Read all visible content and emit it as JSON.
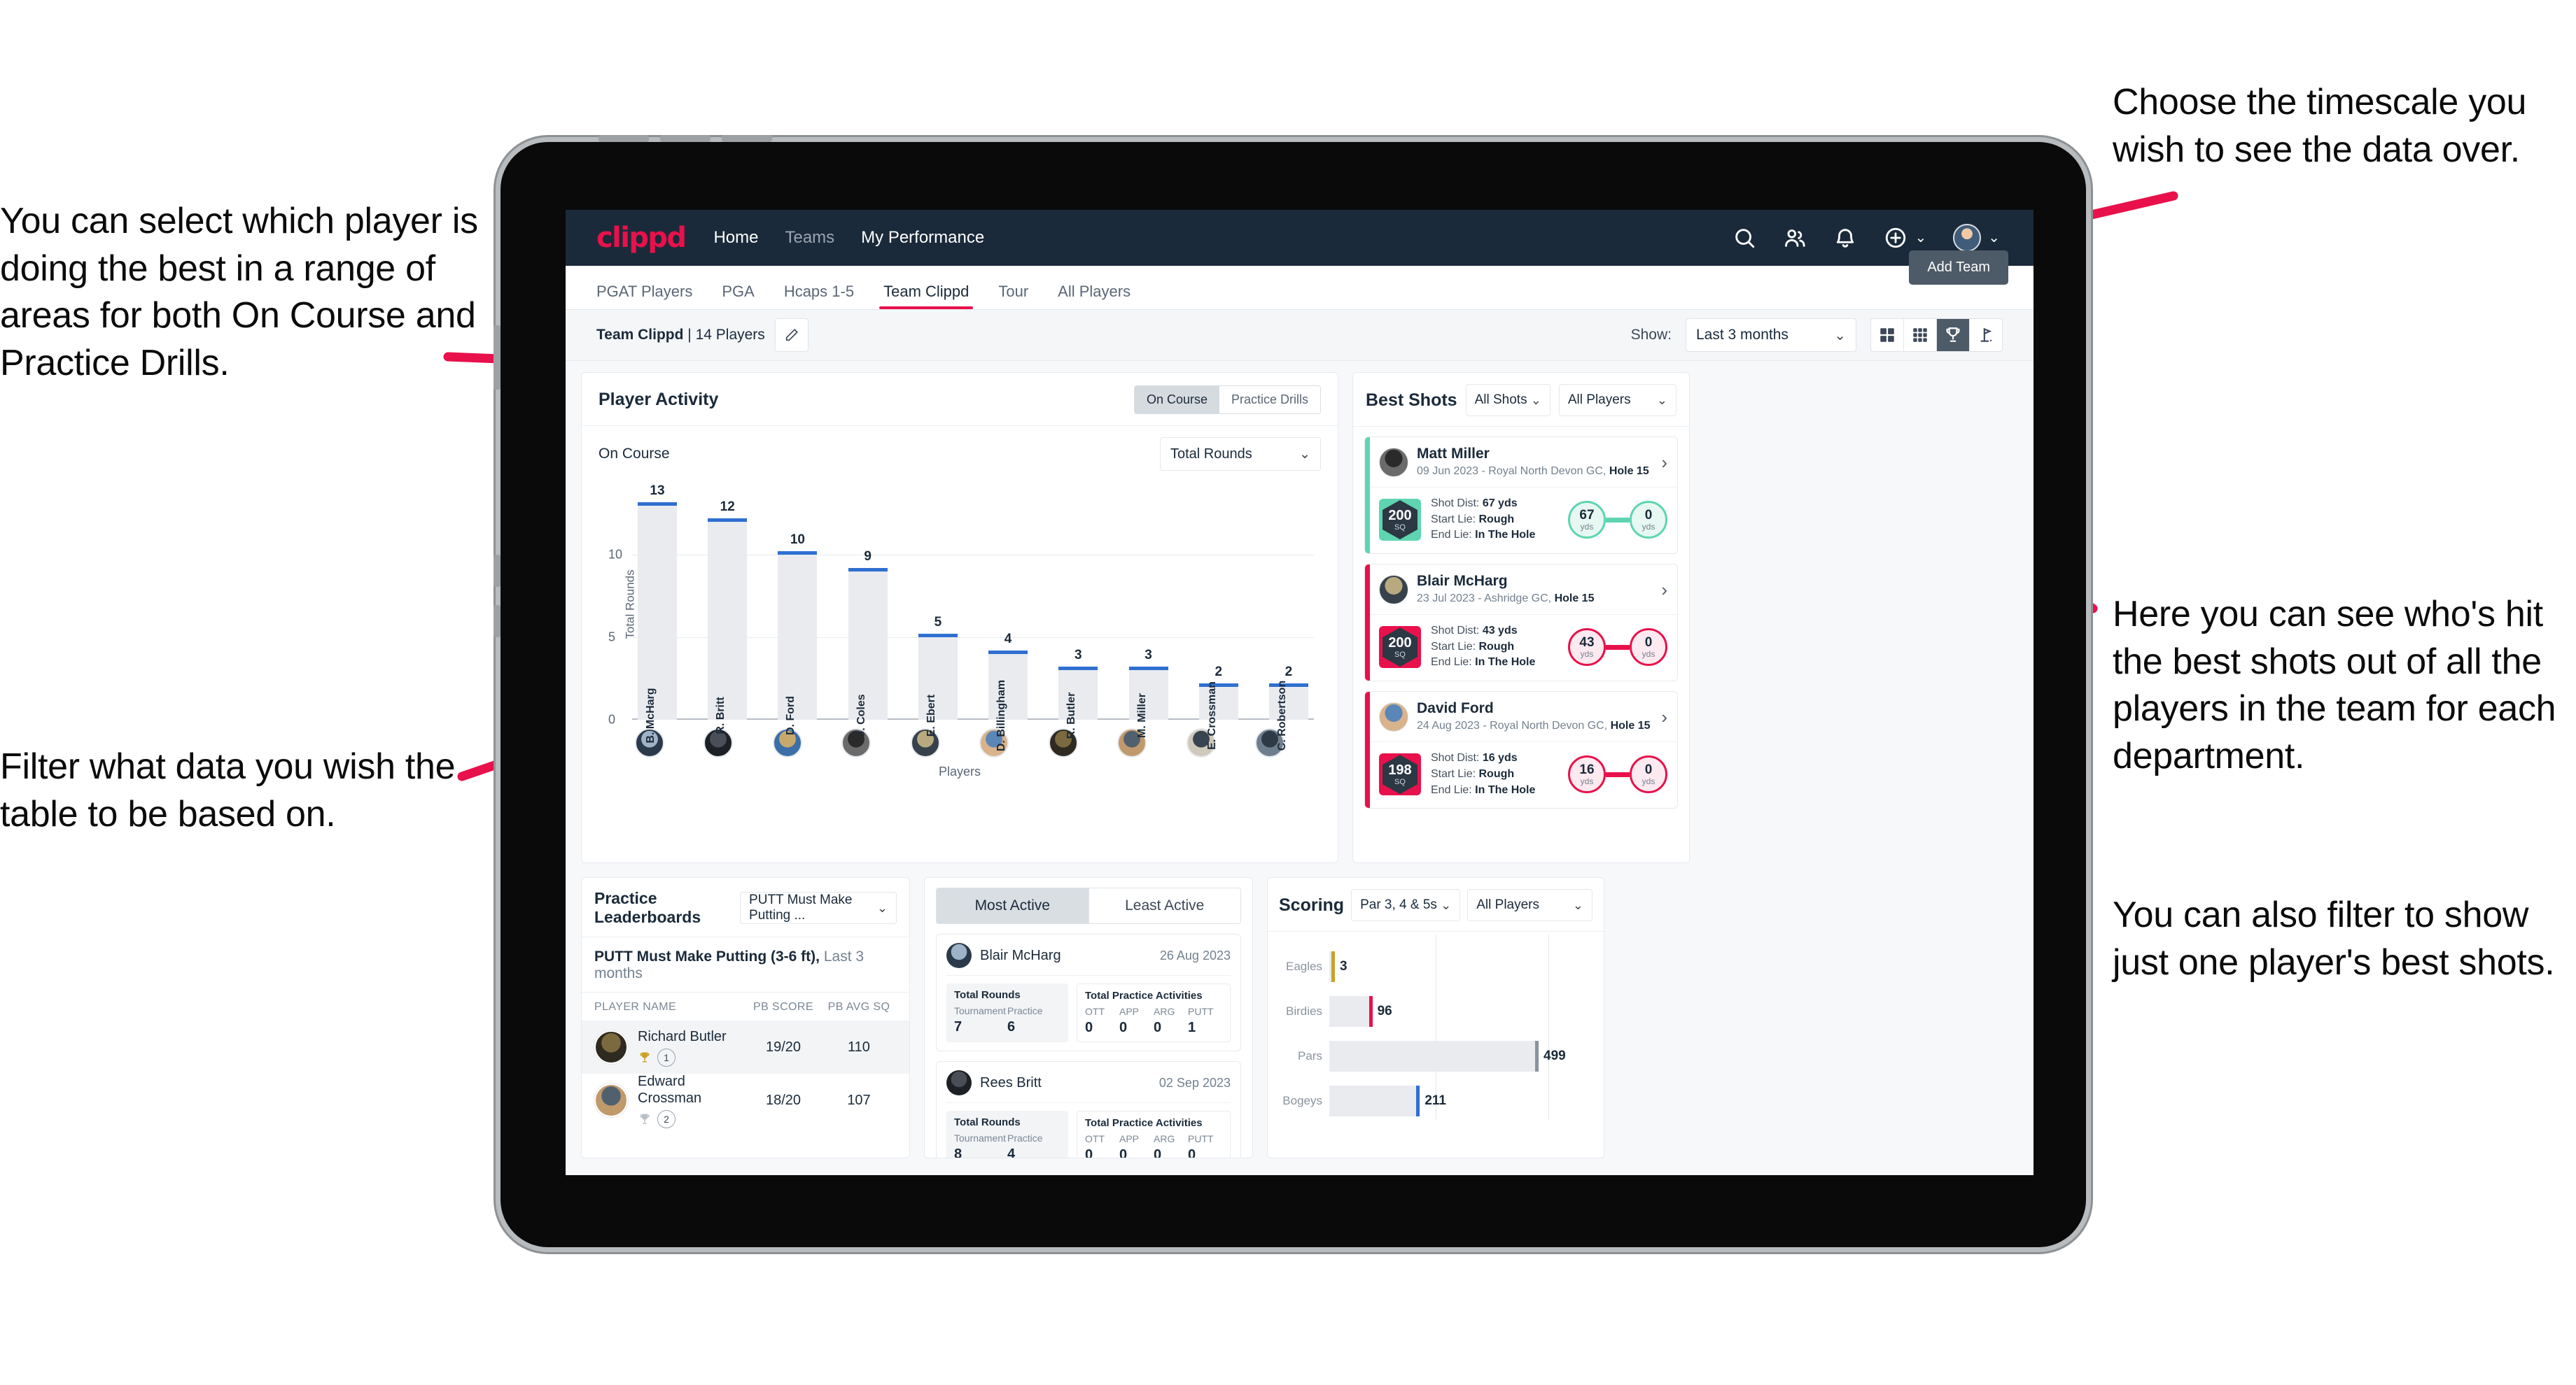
{
  "annotations": {
    "left_top": "You can select which player is doing the best in a range of areas for both On Course and Practice Drills.",
    "left_bottom": "Filter what data you wish the table to be based on.",
    "right_top": "Choose the timescale you wish to see the data over.",
    "right_mid": "Here you can see who's hit the best shots out of all the players in the team for each department.",
    "right_bottom": "You can also filter to show just one player's best shots."
  },
  "navbar": {
    "logo": "clippd",
    "links": [
      {
        "label": "Home",
        "active": true
      },
      {
        "label": "Teams",
        "active": false
      },
      {
        "label": "My Performance",
        "active": false
      }
    ],
    "icons": [
      "search-icon",
      "people-icon",
      "bell-icon",
      "plus-circle-icon",
      "avatar"
    ]
  },
  "subtabs": {
    "items": [
      {
        "label": "PGAT Players",
        "active": false
      },
      {
        "label": "PGA",
        "active": false
      },
      {
        "label": "Hcaps 1-5",
        "active": false
      },
      {
        "label": "Team Clippd",
        "active": true
      },
      {
        "label": "Tour",
        "active": false
      },
      {
        "label": "All Players",
        "active": false
      }
    ],
    "add_team_button": "Add Team"
  },
  "toolbar": {
    "team_name": "Team Clippd",
    "team_separator": " | ",
    "team_count": "14 Players",
    "edit_icon": "pencil-icon",
    "show_label": "Show:",
    "show_value": "Last 3 months",
    "view_toggles": [
      {
        "icon": "grid-4-icon",
        "active": false
      },
      {
        "icon": "grid-9-icon",
        "active": false
      },
      {
        "icon": "trophy-icon",
        "active": true
      },
      {
        "icon": "golf-flag-icon",
        "active": false
      }
    ]
  },
  "player_activity": {
    "title": "Player Activity",
    "segments": [
      {
        "label": "On Course",
        "active": true
      },
      {
        "label": "Practice Drills",
        "active": false
      }
    ],
    "sub_label": "On Course",
    "metric_select": "Total Rounds"
  },
  "chart_data": {
    "type": "bar",
    "title": "Player Activity — On Course",
    "xlabel": "Players",
    "ylabel": "Total Rounds",
    "ylim": [
      0,
      14
    ],
    "yticks": [
      0,
      5,
      10
    ],
    "grid": true,
    "categories": [
      "B. McHarg",
      "R. Britt",
      "D. Ford",
      "J. Coles",
      "E. Ebert",
      "D. Billingham",
      "R. Butler",
      "M. Miller",
      "E. Crossman",
      "C. Robertson"
    ],
    "values": [
      13,
      12,
      10,
      9,
      5,
      4,
      3,
      3,
      2,
      2
    ]
  },
  "best_shots": {
    "title": "Best Shots",
    "shot_filter": "All Shots",
    "player_filter": "All Players",
    "cards": [
      {
        "player": "Matt Miller",
        "meta_date": "09 Jun 2023",
        "meta_course": "Royal North Devon GC,",
        "meta_hole": "Hole 15",
        "sq_value": "200",
        "sq_unit": "SQ",
        "accent": "#5ed5b0",
        "shot_dist_label": "Shot Dist:",
        "shot_dist_value": "67 yds",
        "start_lie_label": "Start Lie:",
        "start_lie_value": "Rough",
        "end_lie_label": "End Lie:",
        "end_lie_value": "In The Hole",
        "start_num": "67",
        "start_unit": "yds",
        "end_num": "0",
        "end_unit": "yds"
      },
      {
        "player": "Blair McHarg",
        "meta_date": "23 Jul 2023",
        "meta_course": "Ashridge GC,",
        "meta_hole": "Hole 15",
        "sq_value": "200",
        "sq_unit": "SQ",
        "accent": "#e8114b",
        "shot_dist_label": "Shot Dist:",
        "shot_dist_value": "43 yds",
        "start_lie_label": "Start Lie:",
        "start_lie_value": "Rough",
        "end_lie_label": "End Lie:",
        "end_lie_value": "In The Hole",
        "start_num": "43",
        "start_unit": "yds",
        "end_num": "0",
        "end_unit": "yds"
      },
      {
        "player": "David Ford",
        "meta_date": "24 Aug 2023",
        "meta_course": "Royal North Devon GC,",
        "meta_hole": "Hole 15",
        "sq_value": "198",
        "sq_unit": "SQ",
        "accent": "#e8114b",
        "shot_dist_label": "Shot Dist:",
        "shot_dist_value": "16 yds",
        "start_lie_label": "Start Lie:",
        "start_lie_value": "Rough",
        "end_lie_label": "End Lie:",
        "end_lie_value": "In The Hole",
        "start_num": "16",
        "start_unit": "yds",
        "end_num": "0",
        "end_unit": "yds"
      }
    ]
  },
  "practice_leaderboards": {
    "title": "Practice Leaderboards",
    "drill_select": "PUTT Must Make Putting ...",
    "subtitle_bold": "PUTT Must Make Putting (3-6 ft),",
    "subtitle_light": " Last 3 months",
    "columns": [
      "PLAYER NAME",
      "PB SCORE",
      "PB AVG SQ"
    ],
    "rows": [
      {
        "name": "Richard Butler",
        "rank": "1",
        "trophy": "gold",
        "pb_score": "19/20",
        "pb_avg_sq": "110"
      },
      {
        "name": "Edward Crossman",
        "rank": "2",
        "trophy": "silver",
        "pb_score": "18/20",
        "pb_avg_sq": "107"
      }
    ]
  },
  "activity": {
    "tabs": [
      {
        "label": "Most Active",
        "active": true
      },
      {
        "label": "Least Active",
        "active": false
      }
    ],
    "items": [
      {
        "name": "Blair McHarg",
        "date": "26 Aug 2023",
        "rounds_title": "Total Rounds",
        "rounds_keys": [
          "Tournament",
          "Practice"
        ],
        "rounds_values": [
          "7",
          "6"
        ],
        "practice_title": "Total Practice Activities",
        "practice_keys": [
          "OTT",
          "APP",
          "ARG",
          "PUTT"
        ],
        "practice_values": [
          "0",
          "0",
          "0",
          "1"
        ]
      },
      {
        "name": "Rees Britt",
        "date": "02 Sep 2023",
        "rounds_title": "Total Rounds",
        "rounds_keys": [
          "Tournament",
          "Practice"
        ],
        "rounds_values": [
          "8",
          "4"
        ],
        "practice_title": "Total Practice Activities",
        "practice_keys": [
          "OTT",
          "APP",
          "ARG",
          "PUTT"
        ],
        "practice_values": [
          "0",
          "0",
          "0",
          "0"
        ]
      }
    ]
  },
  "scoring": {
    "title": "Scoring",
    "par_filter": "Par 3, 4 & 5s",
    "player_filter": "All Players",
    "chart": {
      "type": "bar",
      "orientation": "horizontal",
      "categories": [
        "Eagles",
        "Birdies",
        "Pars",
        "Bogeys"
      ],
      "values": [
        3,
        96,
        499,
        211
      ],
      "colors": [
        "#c9a227",
        "#e8114b",
        "#8a939d",
        "#2f6fd0"
      ],
      "xmax": 560
    }
  }
}
